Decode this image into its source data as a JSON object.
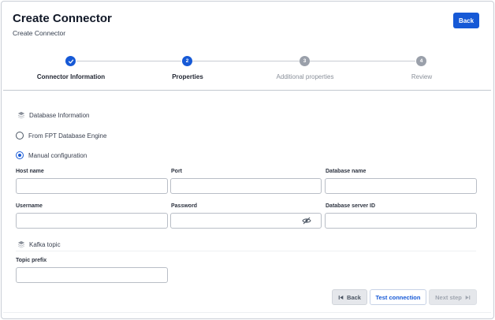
{
  "header": {
    "title": "Create Connector",
    "subtitle": "Create Connector",
    "back_label": "Back"
  },
  "stepper": {
    "steps": [
      {
        "number": "",
        "label": "Connector Information",
        "state": "done"
      },
      {
        "number": "2",
        "label": "Properties",
        "state": "active"
      },
      {
        "number": "3",
        "label": "Additional properties",
        "state": "pending"
      },
      {
        "number": "4",
        "label": "Review",
        "state": "pending"
      }
    ]
  },
  "database_section": {
    "title": "Database Information",
    "icon": "layers-icon",
    "options": [
      {
        "label": "From FPT Database Engine",
        "checked": false
      },
      {
        "label": "Manual configuration",
        "checked": true
      }
    ]
  },
  "fields": {
    "host_name": {
      "label": "Host name",
      "value": ""
    },
    "port": {
      "label": "Port",
      "value": ""
    },
    "database_name": {
      "label": "Database name",
      "value": ""
    },
    "username": {
      "label": "Username",
      "value": ""
    },
    "password": {
      "label": "Password",
      "value": ""
    },
    "database_server_id": {
      "label": "Database server ID",
      "value": ""
    }
  },
  "kafka_section": {
    "title": "Kafka topic",
    "icon": "layers-icon",
    "topic_prefix": {
      "label": "Topic prefix",
      "value": ""
    }
  },
  "footer": {
    "back_label": "Back",
    "test_label": "Test connection",
    "next_label": "Next step"
  },
  "colors": {
    "accent": "#1659d6",
    "pending_step": "#9aa0aa",
    "border": "#b9bec6"
  }
}
